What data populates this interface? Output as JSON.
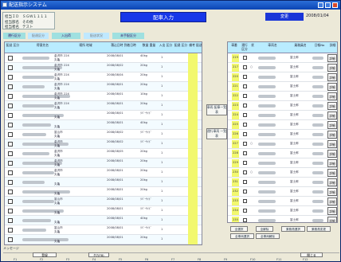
{
  "window": {
    "title": "配送指示システム"
  },
  "info": {
    "rows": [
      {
        "label": "担当ＩＤ",
        "value": "ＳＧＷ１１１１"
      },
      {
        "label": "担当部名",
        "value": "その他"
      },
      {
        "label": "担当者名",
        "value": "テスト"
      }
    ]
  },
  "heading": {
    "text": "配車入力"
  },
  "status": {
    "tag": "変更",
    "date": "2008/01/04"
  },
  "filter_tabs": [
    "運行区分",
    "配達区分",
    "入出荷",
    "配送状況",
    "未手配区分"
  ],
  "left": {
    "headers": [
      "配送\n区分",
      "得意先名",
      "場所\n地域",
      "積込日時\n到着日時",
      "数量\n重量",
      "入出\n区分",
      "配達\n区分",
      "備考\n配送"
    ],
    "rows": [
      {
        "addr": "金沢市 22X",
        "code": "丸亀",
        "date": "2008/08/01",
        "wt": "40kg",
        "n": "1"
      },
      {
        "addr": "金沢市 22X",
        "code": "丸亀",
        "date": "2008/08/02",
        "wt": "20kg",
        "n": "1"
      },
      {
        "addr": "金沢市 22X",
        "code": "丸亀",
        "date": "2008/08/04",
        "wt": "20kg",
        "n": "1"
      },
      {
        "addr": "金沢市 22X",
        "code": "丸亀",
        "date": "2008/08/01",
        "wt": "20kg",
        "n": "1"
      },
      {
        "addr": "金沢市 22X",
        "code": "丸亀",
        "date": "2008/08/01",
        "wt": "10kg",
        "n": "1"
      },
      {
        "addr": "金沢市 22X",
        "code": "丸亀",
        "date": "2008/08/01",
        "wt": "20kg",
        "n": "1"
      },
      {
        "addr": "",
        "code": "丸亀",
        "date": "2008/08/01",
        "wt": "ﾘﾊﾞｰｻｲﾄﾞ",
        "n": "1"
      },
      {
        "addr": "",
        "code": "丸亀",
        "date": "2008/08/01",
        "wt": "40kg",
        "n": "1"
      },
      {
        "addr": "富山市",
        "code": "丸亀",
        "date": "2008/08/02",
        "wt": "ﾘﾊﾞｰｻｲﾄﾞ",
        "n": "1"
      },
      {
        "addr": "金沢市",
        "code": "丸亀",
        "date": "2008/08/02",
        "wt": "ﾘﾊﾞｰｻｲﾄﾞ",
        "n": "1"
      },
      {
        "addr": "金沢市",
        "code": "丸亀",
        "date": "2008/08/05",
        "wt": "20kg",
        "n": "1"
      },
      {
        "addr": "金沢市",
        "code": "丸亀",
        "date": "2008/08/01",
        "wt": "20kg",
        "n": "1"
      },
      {
        "addr": "金沢市",
        "code": "丸亀",
        "date": "2008/08/01",
        "wt": "20kg",
        "n": "1"
      },
      {
        "addr": "",
        "code": "丸亀",
        "date": "2008/08/01",
        "wt": "20kg",
        "n": "1"
      },
      {
        "addr": "",
        "code": "丸亀",
        "date": "2008/08/01",
        "wt": "20kg",
        "n": "1"
      },
      {
        "addr": "富山市",
        "code": "丸亀",
        "date": "2008/08/01",
        "wt": "ﾘﾊﾞｰｻｲﾄﾞ",
        "n": "1"
      },
      {
        "addr": "",
        "code": "丸亀",
        "date": "2008/08/01",
        "wt": "ﾘﾊﾞｰｻｲﾄﾞ",
        "n": "1"
      },
      {
        "addr": "",
        "code": "丸亀",
        "date": "2008/08/01",
        "wt": "40kg",
        "n": "1"
      },
      {
        "addr": "富山市",
        "code": "丸亀",
        "date": "2008/08/01",
        "wt": "ﾘﾊﾞｰｻｲﾄﾞ",
        "n": "1"
      },
      {
        "addr": "",
        "code": "丸亀",
        "date": "2008/08/01",
        "wt": "20kg",
        "n": "1"
      }
    ]
  },
  "middle": {
    "btn1": "車両\n配車一覧表",
    "btn2": "運行車両\n一覧表"
  },
  "right": {
    "headers": [
      "車番",
      "運行\n区分",
      "状",
      "車両名",
      "乗務員名",
      "日報No",
      "詳細"
    ],
    "rows": [
      {
        "no": "219"
      },
      {
        "no": "217",
        "check": "○"
      },
      {
        "no": "220"
      },
      {
        "no": "221"
      },
      {
        "no": "222"
      },
      {
        "no": "223"
      },
      {
        "no": "224"
      },
      {
        "no": "225"
      },
      {
        "no": "226"
      },
      {
        "no": "227",
        "check": "○"
      },
      {
        "no": "228"
      },
      {
        "no": "229"
      },
      {
        "no": "230",
        "check": "○"
      },
      {
        "no": "231"
      },
      {
        "no": "232"
      },
      {
        "no": "233"
      },
      {
        "no": "234"
      },
      {
        "no": "235"
      }
    ],
    "detail_label": "詳細",
    "name_label": "富士郎",
    "buttons": [
      "全選択",
      "全解除",
      "乗務員選択",
      "乗務員変更",
      "全車両選択",
      "全車両解除"
    ]
  },
  "footer": {
    "message_label": "メッセージ",
    "btn_left": "登録",
    "btn_mid": "ｸﾘｱ(F8)",
    "btn_right": "閉じる",
    "fkeys": [
      "F1",
      "F2",
      "F3",
      "F4",
      "F5",
      "F6",
      "F7",
      "F8",
      "F9",
      "F10",
      "F11",
      "F12"
    ]
  }
}
